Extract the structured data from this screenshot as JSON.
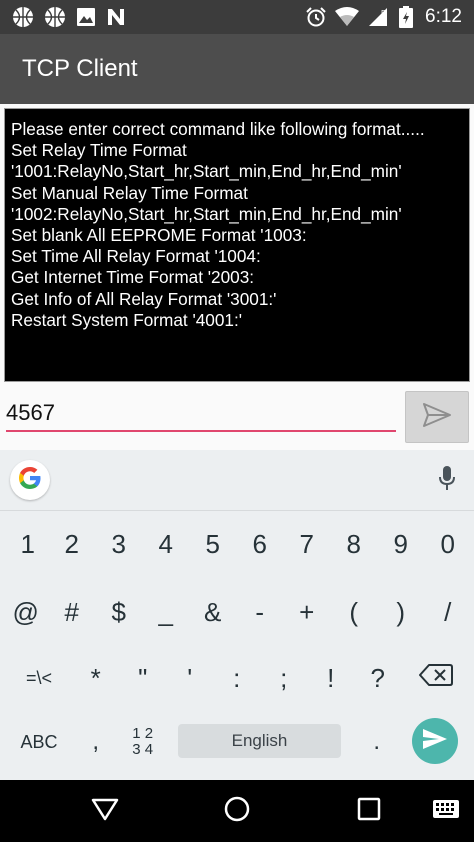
{
  "status_bar": {
    "left_icons": [
      "basketball-icon",
      "basketball-icon",
      "image-icon",
      "n-icon"
    ],
    "right_icons": [
      "alarm-icon",
      "wifi-icon",
      "cell-signal-icon",
      "battery-icon"
    ],
    "roaming_indicator": "R",
    "time": "6:12"
  },
  "app_bar": {
    "title": "TCP Client"
  },
  "console": {
    "lines": [
      "Please enter correct command like following format.....",
      "Set Relay Time Format",
      "'1001:RelayNo,Start_hr,Start_min,End_hr,End_min'",
      "Set Manual Relay Time Format",
      "'1002:RelayNo,Start_hr,Start_min,End_hr,End_min'",
      "Set blank All EEPROME Format '1003:",
      "Set Time All Relay Format '1004:",
      "Get Internet Time Format '2003:",
      "Get Info of All Relay Format '3001:'",
      "Restart System Format '4001:'"
    ]
  },
  "input": {
    "value": "4567",
    "send_icon": "send-icon"
  },
  "keyboard": {
    "google_icon": "google-g-icon",
    "mic_icon": "mic-icon",
    "row1": [
      "1",
      "2",
      "3",
      "4",
      "5",
      "6",
      "7",
      "8",
      "9",
      "0"
    ],
    "row2": [
      "@",
      "#",
      "$",
      "_",
      "&",
      "-",
      "+",
      "(",
      ")",
      "/"
    ],
    "row3": [
      "=\\<",
      "*",
      "\"",
      "'",
      ":",
      ";",
      "!",
      "?"
    ],
    "backspace_icon": "backspace-icon",
    "abc_label": "ABC",
    "comma": ",",
    "numpad_top": "1 2",
    "numpad_bottom": "3 4",
    "space_label": "English",
    "period": ".",
    "enter_icon": "send-icon",
    "accent_color": "#4db6ac"
  },
  "nav_bar": {
    "icons": [
      "back-icon",
      "home-icon",
      "recents-icon",
      "keyboard-switch-icon"
    ]
  },
  "colors": {
    "underline": "#e0466e",
    "app_bar": "#4d4d4d",
    "status_bar": "#3c3c3c"
  }
}
